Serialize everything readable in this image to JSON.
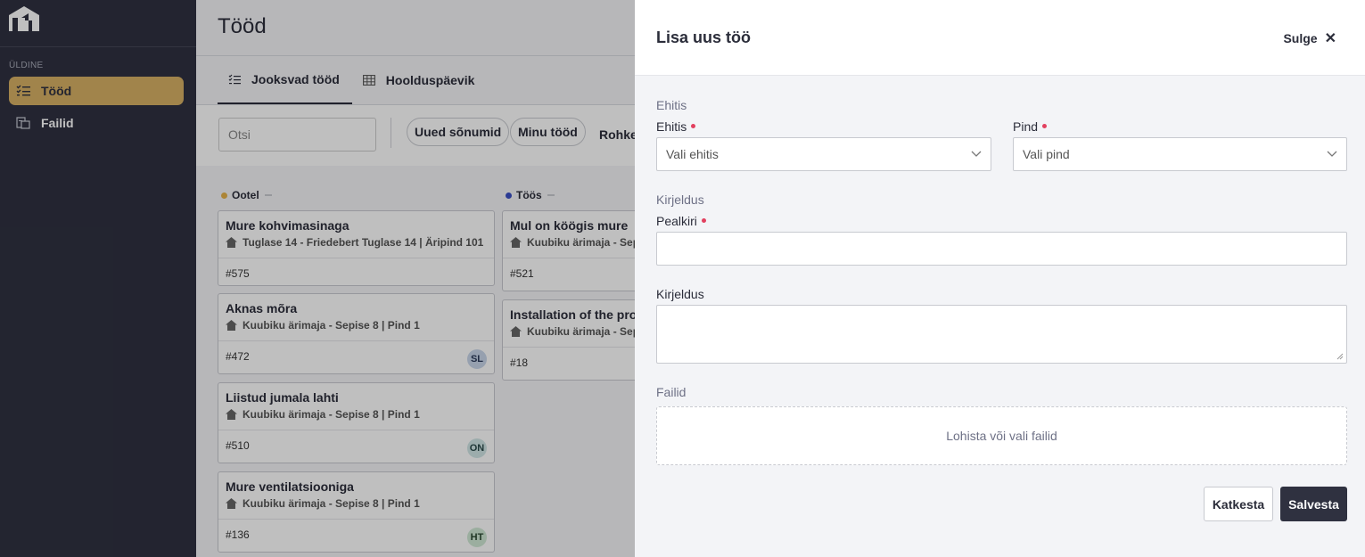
{
  "sidebar": {
    "section_label": "ÜLDINE",
    "items": [
      {
        "label": "Tööd",
        "icon": "list-check-icon",
        "active": true
      },
      {
        "label": "Failid",
        "icon": "files-icon",
        "active": false
      }
    ]
  },
  "main": {
    "title": "Tööd",
    "tabs": [
      {
        "label": "Jooksvad tööd",
        "icon": "list-check-icon",
        "active": true
      },
      {
        "label": "Hoolduspäevik",
        "icon": "table-icon",
        "active": false
      }
    ],
    "search_placeholder": "Otsi",
    "filters": [
      "Uued sõnumid",
      "Minu tööd"
    ],
    "more_label": "Rohke",
    "columns": [
      {
        "name": "Ootel",
        "color": "#e6b24a",
        "cards": [
          {
            "title": "Mure kohvimasinaga",
            "location": "Tuglase 14 - Friedebert Tuglase 14 | Äripind 101",
            "number": "#575",
            "avatar": ""
          },
          {
            "title": "Aknas mõra",
            "location": "Kuubiku ärimaja - Sepise 8 | Pind 1",
            "number": "#472",
            "avatar": "SL"
          },
          {
            "title": "Liistud jumala lahti",
            "location": "Kuubiku ärimaja - Sepise 8 | Pind 1",
            "number": "#510",
            "avatar": "ON"
          },
          {
            "title": "Mure ventilatsiooniga",
            "location": "Kuubiku ärimaja - Sepise 8 | Pind 1",
            "number": "#136",
            "avatar": "HT"
          }
        ]
      },
      {
        "name": "Töös",
        "color": "#3a4fc4",
        "cards": [
          {
            "title": "Mul on köögis mure",
            "location": "Kuubiku ärimaja - Sepi",
            "number": "#521",
            "avatar": ""
          },
          {
            "title": "Installation of the proj",
            "location": "Kuubiku ärimaja - Sepi",
            "number": "#18",
            "avatar": ""
          }
        ]
      }
    ]
  },
  "drawer": {
    "title": "Lisa uus töö",
    "close_label": "Sulge",
    "section_building": "Ehitis",
    "building_label": "Ehitis",
    "building_placeholder": "Vali ehitis",
    "area_label": "Pind",
    "area_placeholder": "Vali pind",
    "section_description": "Kirjeldus",
    "heading_label": "Pealkiri",
    "heading_value": "",
    "description_label": "Kirjeldus",
    "description_value": "",
    "section_files": "Failid",
    "dropzone_text": "Lohista või vali failid",
    "cancel_label": "Katkesta",
    "save_label": "Salvesta"
  }
}
